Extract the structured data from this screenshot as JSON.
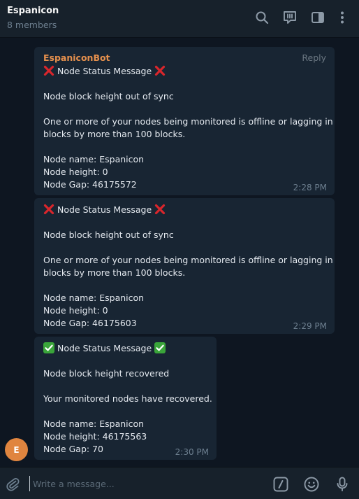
{
  "header": {
    "title": "Espanicon",
    "subtitle": "8 members",
    "icons": [
      "search-icon",
      "video-chat-icon",
      "sidebar-toggle-icon",
      "more-vertical-icon"
    ]
  },
  "messages": [
    {
      "sender": "EspaniconBot",
      "reply_label": "Reply",
      "title": "Node Status Message",
      "status_emoji": "cross-mark",
      "lines": [
        "",
        "Node block height out of sync",
        "",
        "One or more of your nodes being monitored is offline or lagging in",
        "blocks by more than 100 blocks.",
        "",
        "Node name: Espanicon",
        "Node height: 0",
        "Node Gap: 46175572"
      ],
      "time": "2:28 PM"
    },
    {
      "title": "Node Status Message",
      "status_emoji": "cross-mark",
      "lines": [
        "",
        "Node block height out of sync",
        "",
        "One or more of your nodes being monitored is offline or lagging in",
        "blocks by more than 100 blocks.",
        "",
        "Node name: Espanicon",
        "Node height: 0",
        "Node Gap: 46175603"
      ],
      "time": "2:29 PM"
    },
    {
      "title": "Node Status Message",
      "status_emoji": "check-mark",
      "lines": [
        "",
        "Node block height recovered",
        "",
        "Your monitored nodes have recovered.",
        "",
        "Node name: Espanicon",
        "Node height: 46175563",
        "Node Gap: 70"
      ],
      "time": "2:30 PM"
    }
  ],
  "avatar": {
    "initial": "E",
    "color": "#e0853f"
  },
  "composer": {
    "placeholder": "Write a message...",
    "icons": [
      "attach-icon",
      "bot-command-icon",
      "emoji-icon",
      "microphone-icon"
    ]
  },
  "colors": {
    "background": "#0e1621",
    "bubble": "#182533",
    "sender": "#e6904d",
    "muted": "#6d7f8f"
  }
}
